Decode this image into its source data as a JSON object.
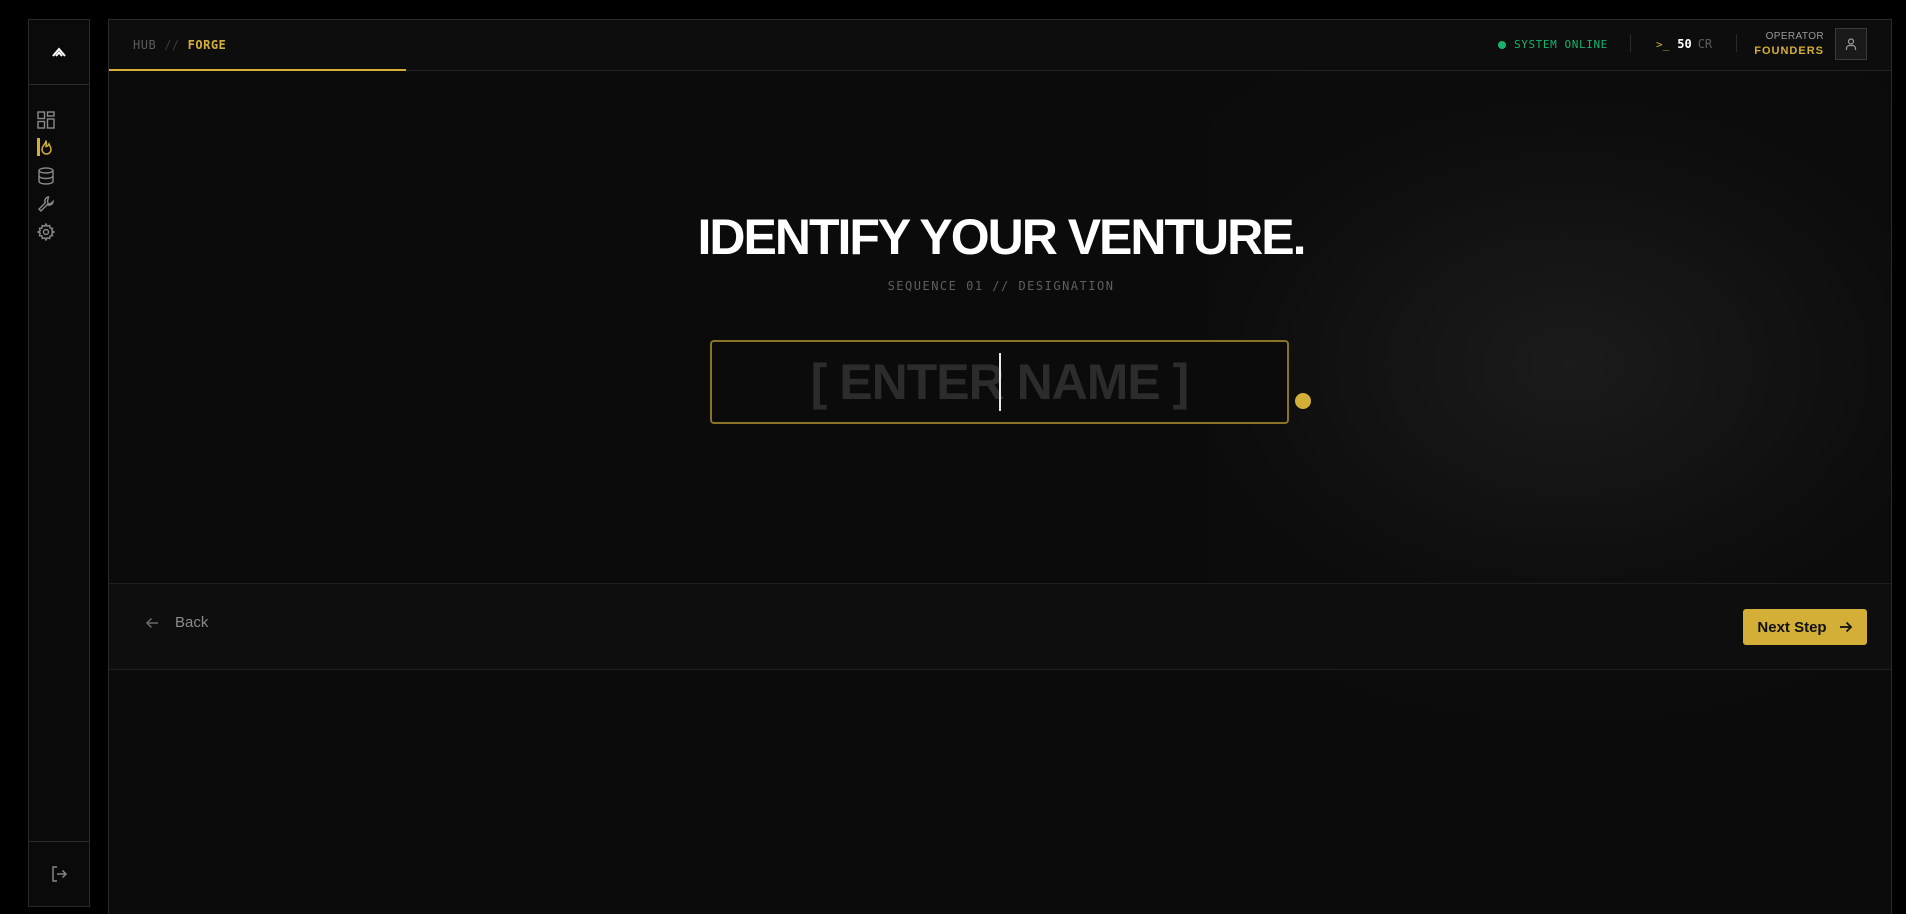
{
  "sidebar": {
    "logo_icon": "chevron-up-logo",
    "items": [
      {
        "icon": "dashboard-grid-icon",
        "active": false
      },
      {
        "icon": "flame-forge-icon",
        "active": true
      },
      {
        "icon": "database-icon",
        "active": false
      },
      {
        "icon": "wrench-icon",
        "active": false
      },
      {
        "icon": "gear-icon",
        "active": false
      }
    ],
    "bottom_icon": "logout-icon"
  },
  "topbar": {
    "breadcrumb": {
      "hub": "HUB",
      "separator": "//",
      "current": "FORGE"
    },
    "status": {
      "text": "SYSTEM ONLINE",
      "color": "#18b26b"
    },
    "credits": {
      "prompt": ">_",
      "value": "50",
      "unit": "CR"
    },
    "operator": {
      "label": "OPERATOR",
      "name": "FOUNDERS"
    },
    "progress_fraction": 0.167
  },
  "hero": {
    "title": "IDENTIFY YOUR VENTURE.",
    "subtitle": "SEQUENCE 01 // DESIGNATION",
    "name_input": {
      "placeholder": "[ ENTER NAME ]",
      "value": ""
    }
  },
  "footer": {
    "back_label": "Back",
    "next_label": "Next Step"
  },
  "colors": {
    "accent": "#d4af37",
    "background": "#0b0b0b",
    "status_online": "#18b26b"
  }
}
